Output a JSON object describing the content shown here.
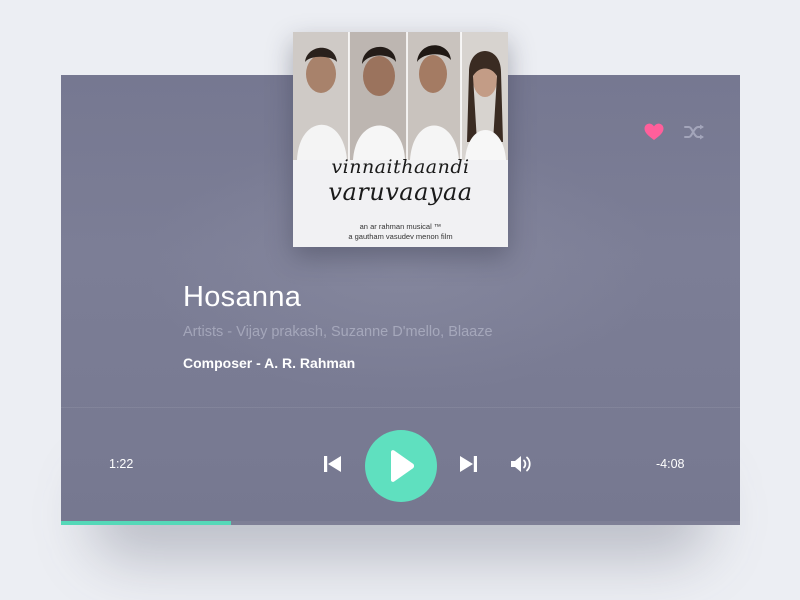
{
  "album_art": {
    "title_line1": "vinnaithaandi",
    "title_line2": "varuvaayaa",
    "credit_line1": "an ar rahman musical ™",
    "credit_line2": "a gautham vasudev menon film"
  },
  "track": {
    "title": "Hosanna",
    "artists": "Artists - Vijay prakash, Suzanne D'mello, Blaaze",
    "composer": "Composer - A. R. Rahman"
  },
  "player": {
    "elapsed": "1:22",
    "remaining": "-4:08",
    "progress_fraction": 0.25,
    "liked": true,
    "state": "paused"
  },
  "icons": {
    "like": "heart-icon",
    "shuffle": "shuffle-icon",
    "previous": "skip-previous-icon",
    "play": "play-icon",
    "next": "skip-next-icon",
    "volume": "volume-icon"
  },
  "colors": {
    "accent": "#5fe0bf",
    "like": "#ff5f9b",
    "card_background": "#7a7c94",
    "page_background": "#eceef3"
  }
}
